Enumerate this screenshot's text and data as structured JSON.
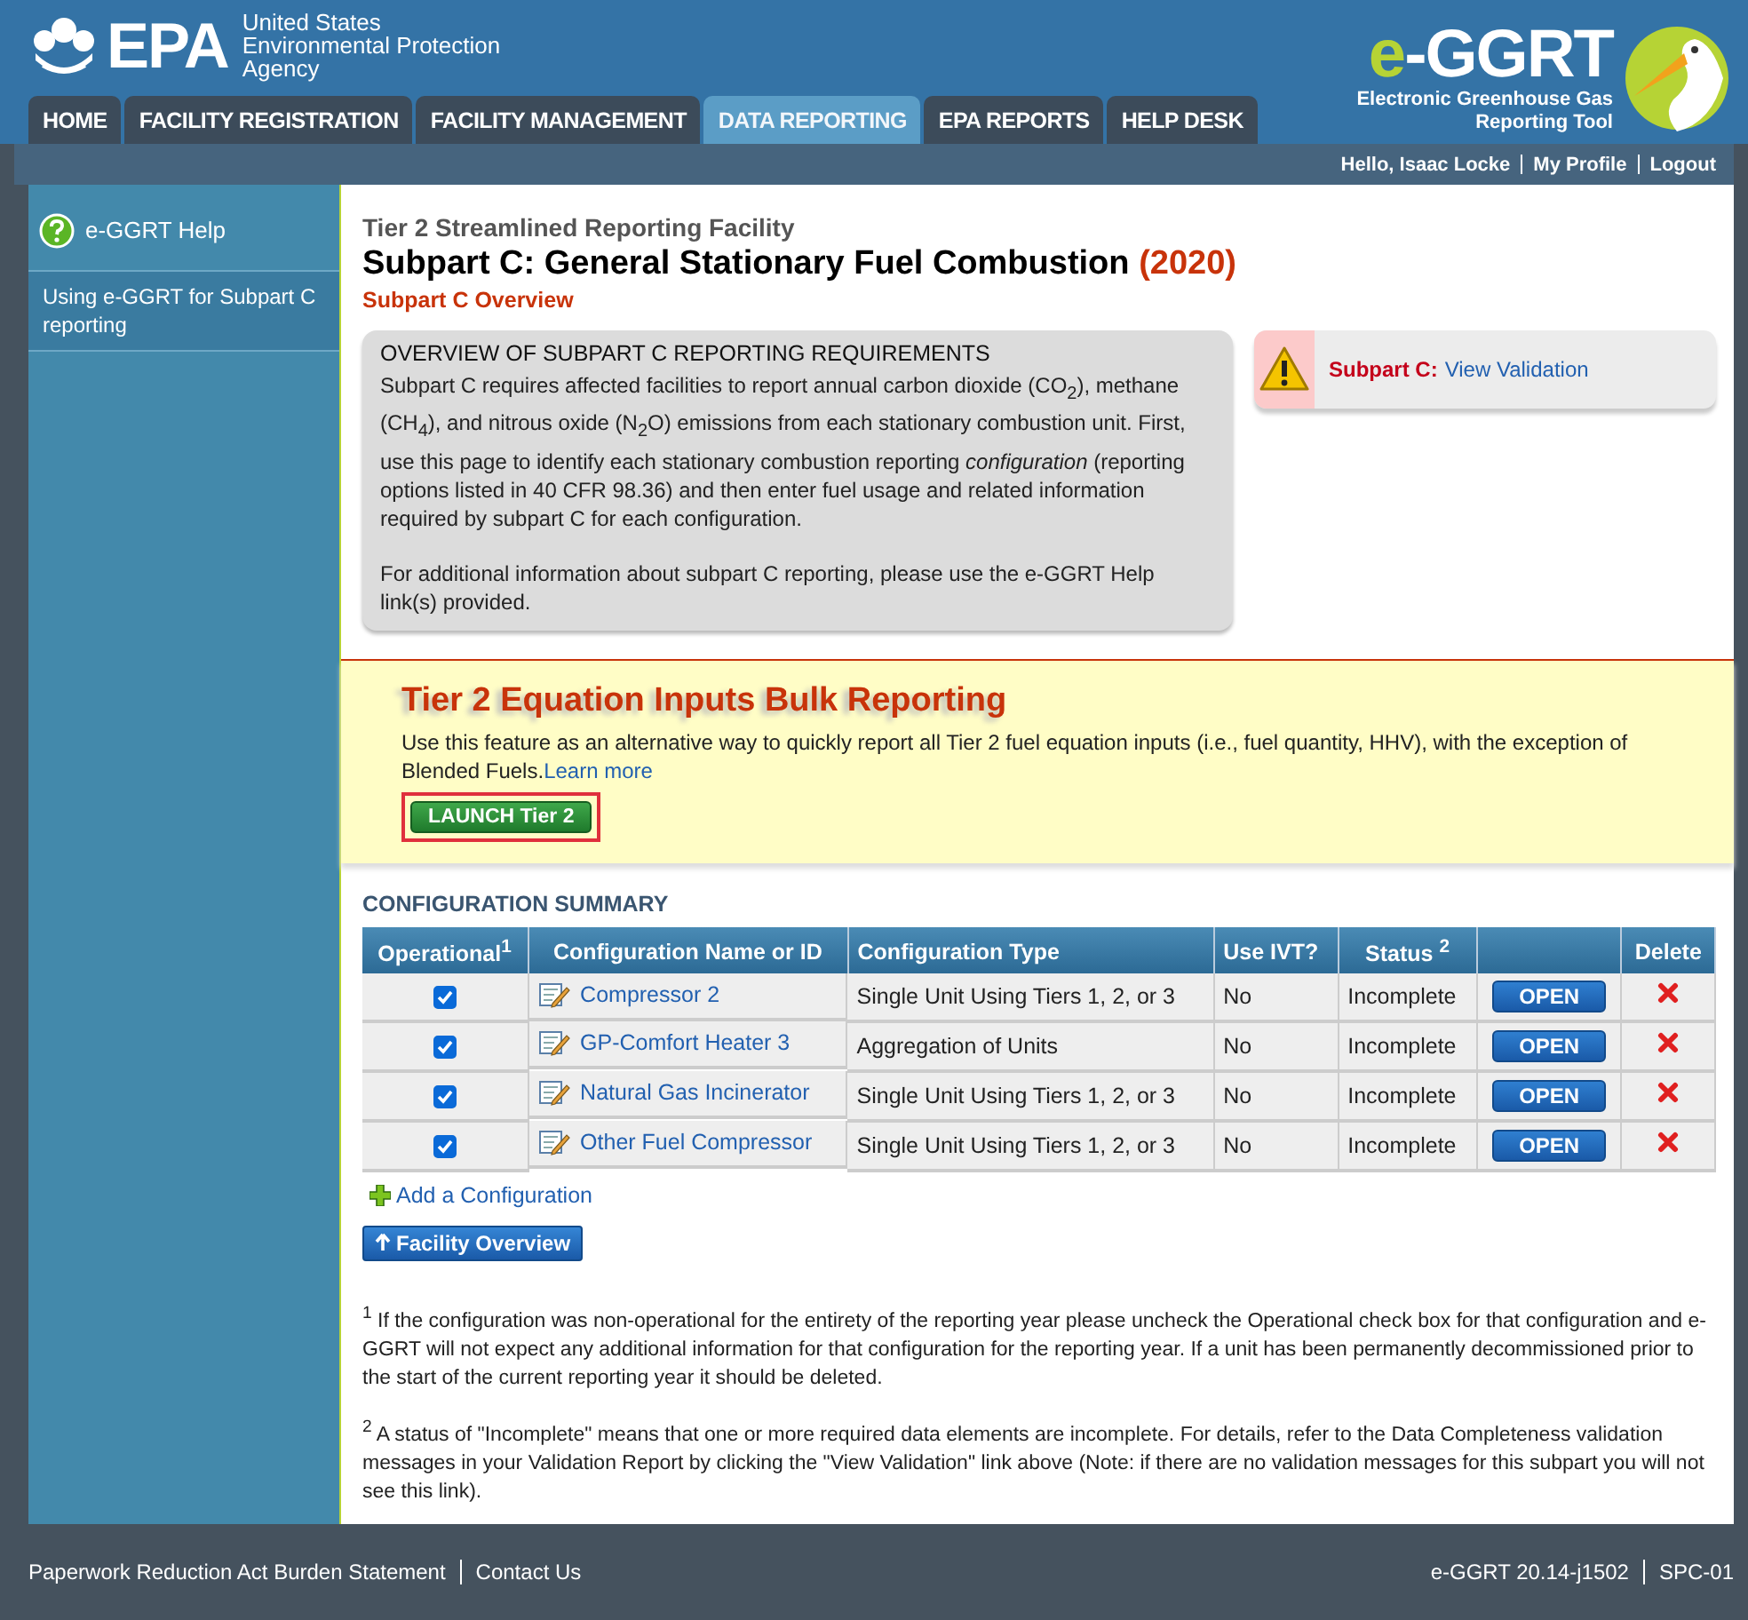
{
  "header": {
    "agency_abbr": "EPA",
    "agency_lines": [
      "United States",
      "Environmental Protection",
      "Agency"
    ],
    "app_logo": {
      "prefix": "e",
      "main": "-GGRT",
      "subtitle_lines": [
        "Electronic Greenhouse Gas",
        "Reporting Tool"
      ]
    }
  },
  "tabs": [
    {
      "label": "HOME",
      "selected": false
    },
    {
      "label": "FACILITY REGISTRATION",
      "selected": false
    },
    {
      "label": "FACILITY MANAGEMENT",
      "selected": false
    },
    {
      "label": "DATA REPORTING",
      "selected": true
    },
    {
      "label": "EPA REPORTS",
      "selected": false
    },
    {
      "label": "HELP DESK",
      "selected": false
    }
  ],
  "user_bar": {
    "greeting": "Hello, Isaac Locke",
    "links": [
      "My Profile",
      "Logout"
    ]
  },
  "sidebar": {
    "title": "e-GGRT Help",
    "items": [
      "Using e-GGRT for Subpart C reporting"
    ]
  },
  "page": {
    "kicker": "Tier 2 Streamlined Reporting Facility",
    "title": "Subpart C: General Stationary Fuel Combustion",
    "year": "(2020)",
    "subtitle": "Subpart C Overview"
  },
  "overview": {
    "heading": "OVERVIEW OF SUBPART C REPORTING REQUIREMENTS",
    "paragraphs": [
      "Subpart C requires affected facilities to report annual carbon dioxide (CO$_{2}$), methane (CH$_{4}$), and nitrous oxide (N$_{2}$O) emissions from each stationary combustion unit. First, use this page to identify each stationary combustion reporting *configuration* (reporting options listed in 40 CFR 98.36) and then enter fuel usage and related information required by subpart C for each configuration.",
      "For additional information about subpart C reporting, please use the e-GGRT Help link(s) provided."
    ]
  },
  "validation": {
    "label": "Subpart C:",
    "link": "View Validation"
  },
  "bulk": {
    "title": "Tier 2 Equation Inputs Bulk Reporting",
    "text": "Use this feature as an alternative way to quickly report all Tier 2 fuel equation inputs (i.e., fuel quantity, HHV), with the exception of Blended Fuels.",
    "link": "Learn more",
    "button": "LAUNCH Tier 2",
    "highlighted": true
  },
  "table": {
    "title": "CONFIGURATION SUMMARY",
    "columns": [
      "Operational$^{1}$",
      "Configuration Name or ID",
      "Configuration Type",
      "Use IVT?",
      "Status $^{2}$",
      "",
      "Delete"
    ],
    "rows": [
      {
        "operational": true,
        "name": "Compressor 2",
        "type": "Single Unit Using Tiers 1, 2, or 3",
        "ivt": "No",
        "status": "Incomplete",
        "action": "OPEN"
      },
      {
        "operational": true,
        "name": "GP-Comfort Heater 3",
        "type": "Aggregation of Units",
        "ivt": "No",
        "status": "Incomplete",
        "action": "OPEN"
      },
      {
        "operational": true,
        "name": "Natural Gas Incinerator",
        "type": "Single Unit Using Tiers 1, 2, or 3",
        "ivt": "No",
        "status": "Incomplete",
        "action": "OPEN"
      },
      {
        "operational": true,
        "name": "Other Fuel Compressor",
        "type": "Single Unit Using Tiers 1, 2, or 3",
        "ivt": "No",
        "status": "Incomplete",
        "action": "OPEN"
      }
    ]
  },
  "add_link": "Add a Configuration",
  "back_button": "Facility Overview",
  "footnotes": [
    "$^{1}$ If the configuration was non-operational for the entirety of the reporting year please uncheck the Operational check box for that configuration and e-GGRT will not expect any additional information for that configuration for the reporting year. If a unit has been permanently decommissioned prior to the start of the current reporting year it should be deleted.",
    "$^{2}$ A status of \"Incomplete\" means that one or more required data elements are incomplete. For details, refer to the Data Completeness validation messages in your Validation Report by clicking the \"View Validation\" link above (Note: if there are no validation messages for this subpart you will not see this link)."
  ],
  "footer": {
    "left": [
      "Paperwork Reduction Act Burden Statement",
      "Contact Us"
    ],
    "right": [
      "e-GGRT 20.14-j1502",
      "SPC-01"
    ]
  }
}
